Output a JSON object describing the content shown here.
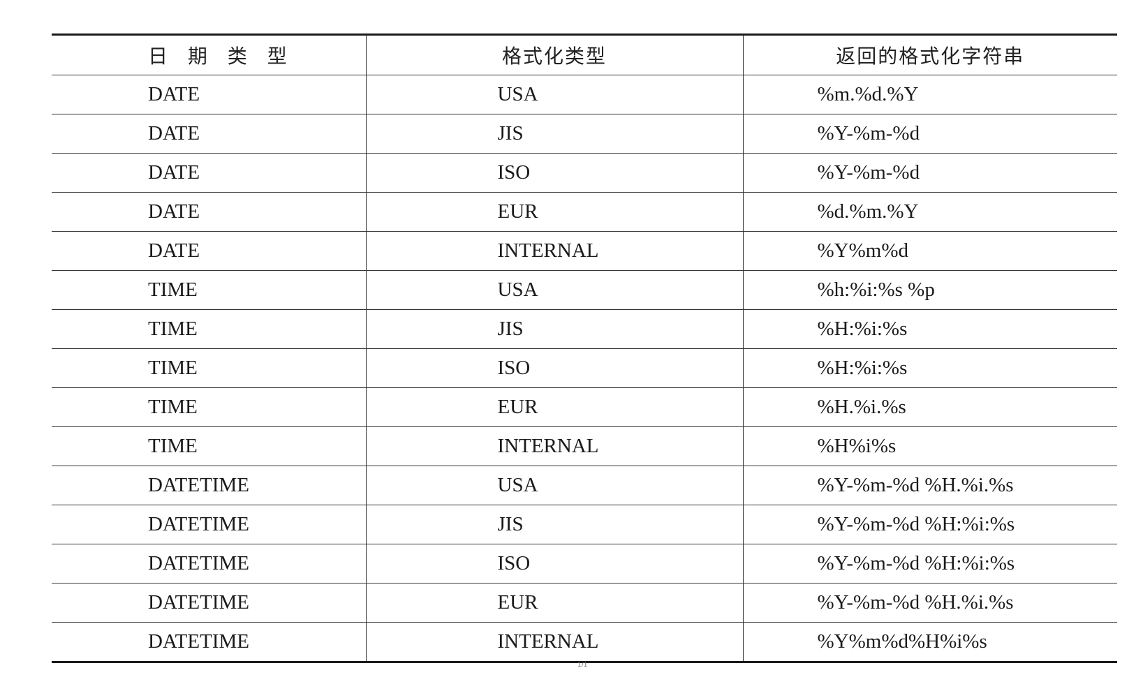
{
  "table": {
    "headers": [
      "日 期 类 型",
      "格式化类型",
      "返回的格式化字符串"
    ],
    "rows": [
      [
        "DATE",
        "USA",
        "%m.%d.%Y"
      ],
      [
        "DATE",
        "JIS",
        "%Y-%m-%d"
      ],
      [
        "DATE",
        "ISO",
        "%Y-%m-%d"
      ],
      [
        "DATE",
        "EUR",
        "%d.%m.%Y"
      ],
      [
        "DATE",
        "INTERNAL",
        "%Y%m%d"
      ],
      [
        "TIME",
        "USA",
        "%h:%i:%s %p"
      ],
      [
        "TIME",
        "JIS",
        "%H:%i:%s"
      ],
      [
        "TIME",
        "ISO",
        "%H:%i:%s"
      ],
      [
        "TIME",
        "EUR",
        "%H.%i.%s"
      ],
      [
        "TIME",
        "INTERNAL",
        "%H%i%s"
      ],
      [
        "DATETIME",
        "USA",
        "%Y-%m-%d %H.%i.%s"
      ],
      [
        "DATETIME",
        "JIS",
        "%Y-%m-%d %H:%i:%s"
      ],
      [
        "DATETIME",
        "ISO",
        "%Y-%m-%d %H:%i:%s"
      ],
      [
        "DATETIME",
        "EUR",
        "%Y-%m-%d %H.%i.%s"
      ],
      [
        "DATETIME",
        "INTERNAL",
        "%Y%m%d%H%i%s"
      ]
    ]
  },
  "page_number": "1/1"
}
